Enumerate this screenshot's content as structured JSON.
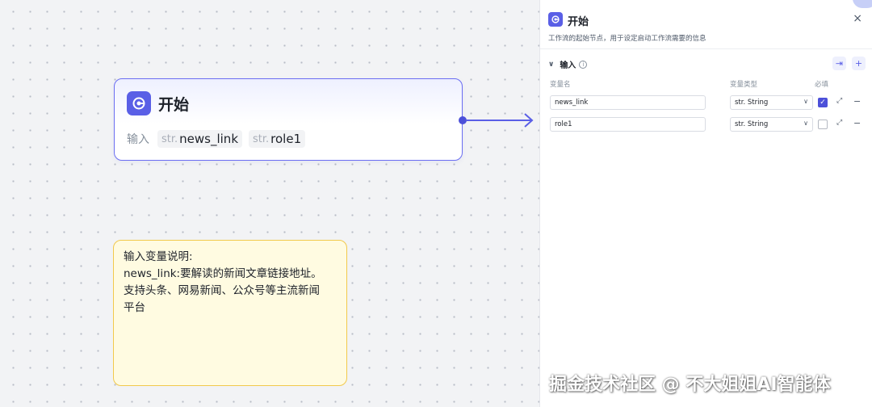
{
  "canvas": {
    "start_node": {
      "title": "开始",
      "inputs_label": "输入",
      "inputs": [
        {
          "type": "str.",
          "name": "news_link"
        },
        {
          "type": "str.",
          "name": "role1"
        }
      ]
    },
    "note": {
      "lines": [
        "输入变量说明:",
        "news_link:要解读的新闻文章链接地址。",
        "支持头条、网易新闻、公众号等主流新闻",
        "平台"
      ]
    }
  },
  "panel": {
    "title": "开始",
    "description": "工作流的起始节点，用于设定启动工作流需要的信息",
    "close_icon": "×",
    "section": {
      "title": "输入",
      "info_icon": "i",
      "import_icon": "⇥",
      "add_icon": "+"
    },
    "columns": {
      "name": "变量名",
      "type": "变量类型",
      "required": "必填"
    },
    "rows": [
      {
        "name": "news_link",
        "type": "str. String",
        "required": true
      },
      {
        "name": "role1",
        "type": "str. String",
        "required": false
      }
    ]
  },
  "watermark": "掘金技术社区 @ 不大姐姐AI智能体",
  "colors": {
    "accent": "#5a5fe6",
    "node_border": "#6b6ef2",
    "note_border": "#f2c94c",
    "note_bg": "#fffbe1"
  }
}
